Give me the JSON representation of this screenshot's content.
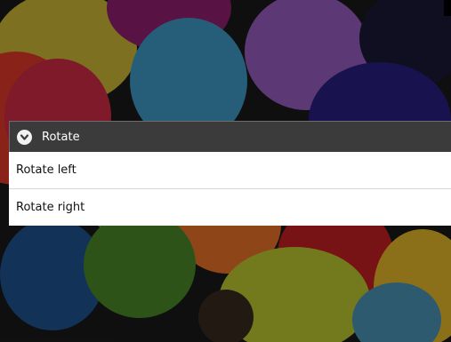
{
  "menu": {
    "title": "Rotate",
    "header_icon": "chevron-down-circle-icon",
    "items": [
      {
        "label": "Rotate left"
      },
      {
        "label": "Rotate right"
      }
    ]
  },
  "background": {
    "description_icon": "balloons-photo"
  },
  "colors": {
    "header_bg": "#3b3b3b",
    "menu_bg": "#ffffff",
    "divider": "#d7d7d7"
  }
}
